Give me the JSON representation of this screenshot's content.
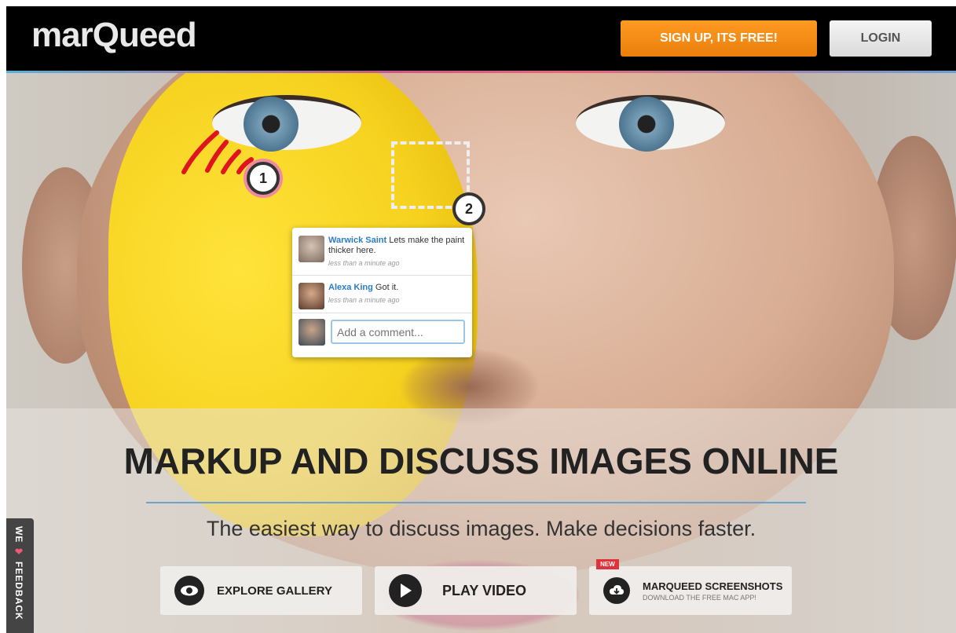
{
  "header": {
    "logo": "marQueed",
    "signup_label": "SIGN UP, ITS FREE!",
    "login_label": "LOGIN"
  },
  "markers": [
    "1",
    "2"
  ],
  "comments": [
    {
      "author": "Warwick Saint",
      "text": "Lets make the paint thicker here.",
      "time": "less than a minute ago"
    },
    {
      "author": "Alexa King",
      "text": "Got it.",
      "time": "less than a minute ago"
    }
  ],
  "comment_input": {
    "placeholder": "Add a comment..."
  },
  "headline": "MARKUP AND DISCUSS IMAGES ONLINE",
  "subheadline": "The easiest way to discuss images. Make decisions faster.",
  "actions": [
    {
      "label": "EXPLORE GALLERY",
      "icon": "eye-icon"
    },
    {
      "label": "PLAY VIDEO",
      "icon": "play-icon"
    },
    {
      "label": "MARQUEED SCREENSHOTS",
      "sublabel": "DOWNLOAD THE FREE MAC APP!",
      "icon": "cloud-download-icon",
      "badge": "NEW"
    }
  ],
  "feedback": {
    "label_we": "WE",
    "icon": "heart-icon",
    "label_feedback": "FEEDBACK"
  },
  "colors": {
    "signup": "#f7901e",
    "accent_blue": "#2a7cc7",
    "marker_ring": "#ef8aa0",
    "stroke_red": "#e0141e"
  }
}
